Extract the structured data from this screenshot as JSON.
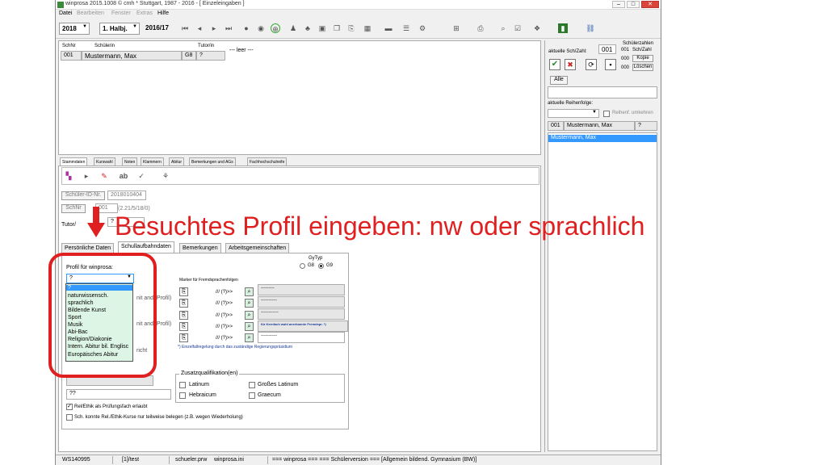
{
  "window": {
    "title": "winprosa 2015.1008 © cmh * Stuttgart, 1987 - 2016 - [ Einzeleingaben ]"
  },
  "menu": {
    "items": [
      "Datei",
      "Bearbeiten",
      "Fenster",
      "Extras",
      "Hilfe"
    ]
  },
  "toolbar": {
    "year": "2018",
    "halfyear": "1. Halbj.",
    "schoolyear": "2016/17"
  },
  "student_table": {
    "headers": {
      "schnr": "SchNr",
      "name": "Schülerin",
      "tutor": "Tutor/in"
    },
    "row": {
      "schnr": "001",
      "name": "Mustermann, Max",
      "g8": "G8",
      "tutor": "?"
    },
    "empty_note": "--- leer ---"
  },
  "right_panel": {
    "aktuelle_label": "aktuelle Sch/Zahl:",
    "aktuelle_value": "001",
    "count_title": "Schülerzahlen",
    "count_rows": [
      {
        "num": "001",
        "text": "Sch/Zahl"
      },
      {
        "num": "000",
        "text": "Kopie"
      },
      {
        "num": "000",
        "text": "Löschen"
      }
    ],
    "alle_button": "Alle",
    "reihenfolge_label": "aktuelle Reihenfolge:",
    "reihenfolge_checkbox": "Reihenf. umkehren",
    "list_row": {
      "schnr": "001",
      "name": "Mustermann, Max",
      "tutor": "?"
    },
    "selected_name": "Mustermann, Max"
  },
  "tabs_main": [
    "Stammdaten",
    "Kurswahl",
    "Noten",
    "Klammern",
    "Abitur",
    "Bemerkungen und AGs",
    "Fachhochschulreife"
  ],
  "stamm": {
    "id_label": "Schüler-ID-Nr.",
    "id_value": "2018010404",
    "schnr_label": "SchNr",
    "schnr_value": "001",
    "version": "(2.21/5/18/0)",
    "tutor_label": "Tutor/",
    "tutor_value": "?"
  },
  "annotation": "Besuchtes Profil eingeben: nw oder sprachlich",
  "tabs_sub": [
    "Persönliche Daten",
    "Schullaufbahndaten",
    "Bemerkungen",
    "Arbeitsgemeinschaften"
  ],
  "laufbahn": {
    "profil_label": "Profil für winprosa:",
    "profil_value": "?",
    "profil_options": [
      "?",
      "naturwissensch.",
      "sprachlich",
      "Bildende Kunst",
      "Sport",
      "Musik",
      "Abi-Bac",
      "Religion/Diakonie",
      "Intern. Abitur bil. Englisc",
      "Europäisches Abitur"
    ],
    "partial_labels": [
      "nit and. Profil)",
      "nit and. Profil)",
      "richt"
    ],
    "gytyp_label": "GyTyp",
    "g8": "G8",
    "g9": "G9",
    "marker_title": "Marker für Fremdsprachenfolgen",
    "marker_rows": [
      "///  (?)>>",
      "///  (?)>>",
      "///  (?)>>",
      "///  (?)>>",
      "///  (?)>>"
    ],
    "marker_values": [
      "----------",
      "------------",
      "-------------",
      "für Kernfach wahl anerkannte Fremdspr. *)",
      "------------"
    ],
    "footnote": "*) Einzelfallregelung durch das zuständige Regierungspräsidium",
    "zusatz_title": "Zusatzqualifikation(en)",
    "zusatz": [
      "Latinum",
      "Großes Latinum",
      "Hebraicum",
      "Graecum"
    ],
    "ethik_value": "??",
    "chk1": "Rel/Ethik als Prüfungsfach erlaubt",
    "chk2": "Sch. konnte Rel./Ethik-Kurse nur teilweise belegen (z.B. wegen Wiederholung)"
  },
  "statusbar": {
    "ws": "WS140995",
    "path": "[1]/test",
    "file1": "schueler.prw",
    "file2": "winprosa.ini",
    "info": "=== winprosa === === Schülerversion === [Allgemein bildend. Gymnasium (BW)]"
  },
  "colors": {
    "annotation": "#e02020",
    "selection": "#3399ff",
    "dropdown_bg": "#ddf5e4"
  }
}
